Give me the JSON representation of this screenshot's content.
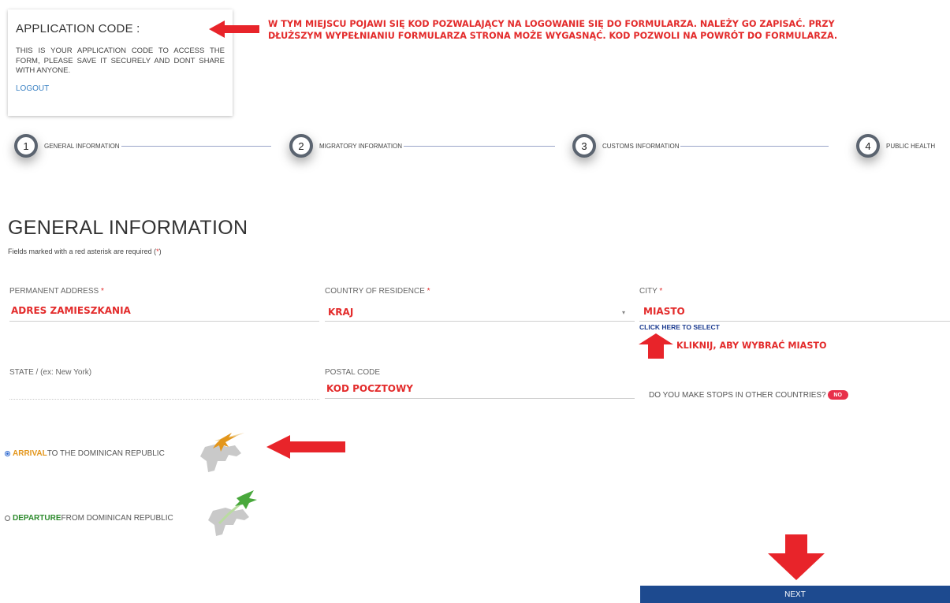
{
  "code_card": {
    "title": "APPLICATION CODE :",
    "text": "THIS IS YOUR APPLICATION CODE TO ACCESS THE FORM, PLEASE SAVE IT SECURELY AND DONT SHARE WITH ANYONE.",
    "logout": "LOGOUT"
  },
  "annotations": {
    "code_note_line1": "W TYM MIEJSCU POJAWI SIĘ KOD POZWALAJĄCY NA LOGOWANIE SIĘ DO FORMULARZA. NALEŻY GO ZAPISAĆ. PRZY",
    "code_note_line2": "DŁUŻSZYM WYPEŁNIANIU FORMULARZA STRONA MOŻE WYGASNĄĆ. KOD POZWOLI NA POWRÓT DO FORMULARZA.",
    "city_note": "KLIKNIJ, ABY WYBRAĆ MIASTO",
    "arrow_color": "#e8242a"
  },
  "steps": [
    {
      "number": "1",
      "label": "GENERAL INFORMATION"
    },
    {
      "number": "2",
      "label": "MIGRATORY INFORMATION"
    },
    {
      "number": "3",
      "label": "CUSTOMS INFORMATION"
    },
    {
      "number": "4",
      "label": "PUBLIC HEALTH"
    }
  ],
  "section": {
    "title": "GENERAL INFORMATION",
    "subtitle_prefix": "Fields marked with a red asterisk are required (",
    "subtitle_asterisk": "*",
    "subtitle_suffix": ")"
  },
  "fields": {
    "permanent_address": {
      "label": "PERMANENT ADDRESS",
      "required": "*",
      "value": "ADRES ZAMIESZKANIA"
    },
    "country": {
      "label": "COUNTRY OF RESIDENCE",
      "required": "*",
      "value": "KRAJ"
    },
    "city": {
      "label": "CITY",
      "required": "*",
      "value": "MIASTO",
      "select_link": "CLICK HERE TO SELECT"
    },
    "state": {
      "label": "STATE / (ex: New York)"
    },
    "postal": {
      "label": "POSTAL CODE",
      "value": "KOD POCZTOWY"
    },
    "stops": {
      "label": "DO YOU MAKE STOPS IN OTHER COUNTRIES?",
      "toggle": "NO"
    }
  },
  "travel": {
    "arrival": {
      "bold": "ARRIVAL",
      "rest": " TO THE DOMINICAN REPUBLIC",
      "checked": true
    },
    "departure": {
      "bold": "DEPARTURE",
      "rest": " FROM DOMINICAN REPUBLIC",
      "checked": false
    }
  },
  "next_button": "NEXT",
  "colors": {
    "accent_blue": "#1d4a8f",
    "required_red": "#e32b2b",
    "arrival_orange": "#e3961b",
    "departure_green": "#2e8b2e"
  }
}
